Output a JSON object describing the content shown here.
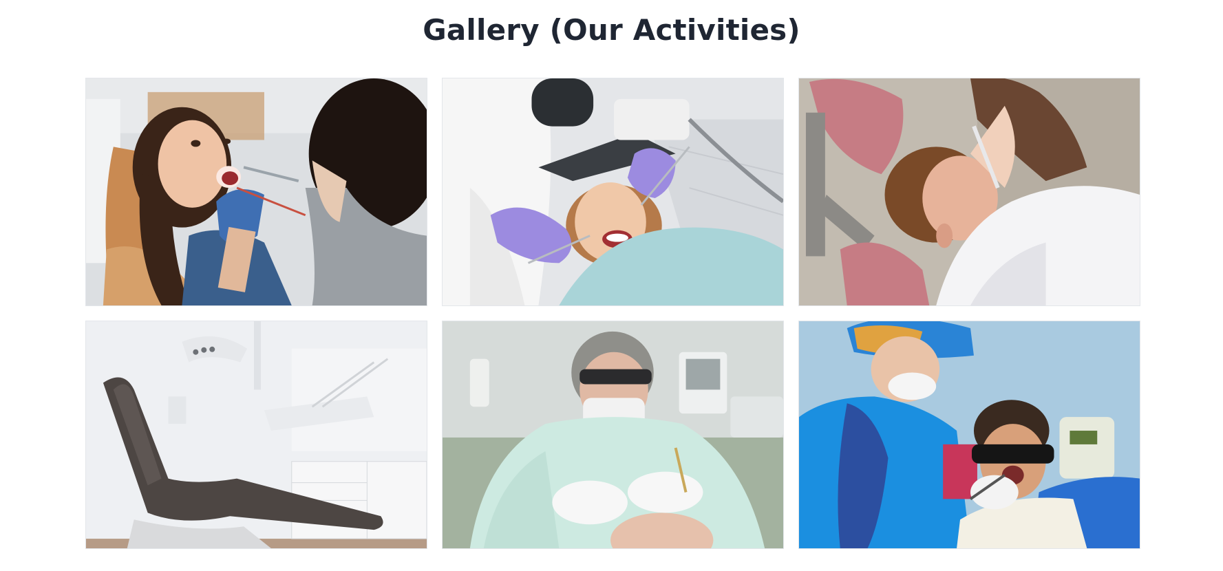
{
  "gallery": {
    "title": "Gallery (Our Activities)",
    "photos": [
      {
        "subject": "patient-smiling-dental-exam",
        "bg": "#d9dcdf",
        "accent": "#4a7fc1"
      },
      {
        "subject": "dentist-examining-patient-teeth",
        "bg": "#dfe2e6",
        "accent": "#9b8be0"
      },
      {
        "subject": "child-patient-with-dentist",
        "bg": "#b9b2a7",
        "accent": "#c97a80"
      },
      {
        "subject": "empty-dental-chair-clinic",
        "bg": "#eef0f3",
        "accent": "#4d4643"
      },
      {
        "subject": "dentist-with-magnifying-loupes",
        "bg": "#c9d3cc",
        "accent": "#cbe9e0"
      },
      {
        "subject": "child-patient-with-sunglasses",
        "bg": "#a7c9df",
        "accent": "#1b8fe0"
      }
    ]
  }
}
